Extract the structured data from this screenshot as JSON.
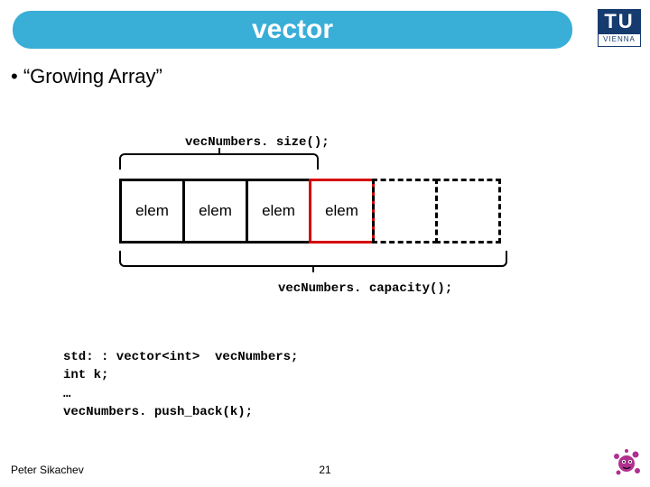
{
  "title": "vector",
  "logo": {
    "top": "TU",
    "bottom": "VIENNA"
  },
  "bullet": "• “Growing Array”",
  "diagram": {
    "size_label": "vecNumbers. size();",
    "capacity_label": "vecNumbers. capacity();",
    "cells": [
      "elem",
      "elem",
      "elem",
      "elem",
      "",
      ""
    ]
  },
  "code": {
    "line1": "std: : vector<int>  vecNumbers;",
    "line2": "int k;",
    "line3": "…",
    "line4": "vecNumbers. push_back(k);"
  },
  "footer": {
    "author": "Peter Sikachev",
    "page": "21"
  }
}
